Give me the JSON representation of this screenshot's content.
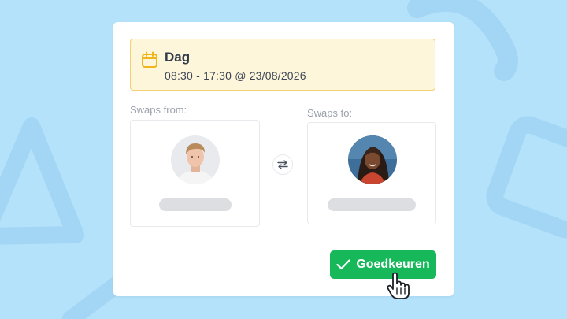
{
  "shift": {
    "title": "Dag",
    "time": "08:30 - 17:30 @ 23/08/2026",
    "icon": "calendar-icon"
  },
  "swap": {
    "from_label": "Swaps from:",
    "to_label": "Swaps to:",
    "icon": "swap-arrows-icon"
  },
  "actions": {
    "approve_label": "Goedkeuren"
  },
  "colors": {
    "background": "#b4e2fb",
    "shift_box_bg": "#fef6da",
    "shift_box_border": "#f2d270",
    "calendar_icon": "#f1b51c",
    "approve_button": "#17b85a"
  }
}
